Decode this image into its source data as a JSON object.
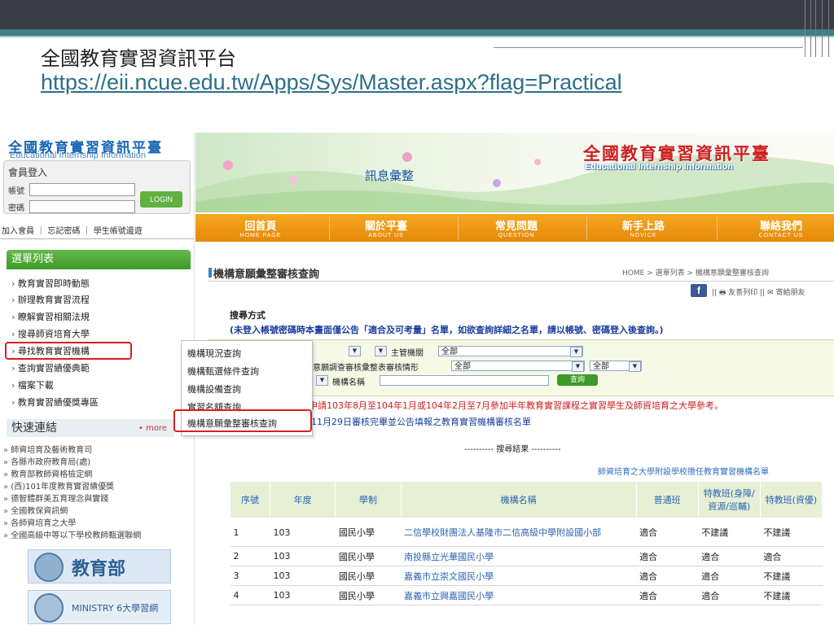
{
  "slide": {
    "title": "全國教育實習資訊平台",
    "url": "https://eii.ncue.edu.tw/Apps/Sys/Master.aspx?flag=Practical"
  },
  "site": {
    "logo_cn": "全國教育實習資訊平臺",
    "logo_en": "Educational Internship Information",
    "banner_center": "訊息彙整",
    "banner_cn": "全國教育實習資訊平臺",
    "banner_en": "Educational Internship Information"
  },
  "login": {
    "title": "會員登入",
    "account_label": "帳號",
    "password_label": "密碼",
    "button": "LOGIN",
    "links": "加入會員 ｜ 忘記密碼 ｜ 學生帳號邊遊"
  },
  "nav": [
    {
      "cn": "回首頁",
      "en": "HOME PAGE"
    },
    {
      "cn": "關於平臺",
      "en": "ABOUT US"
    },
    {
      "cn": "常見問題",
      "en": "QUESTION"
    },
    {
      "cn": "新手上路",
      "en": "NOVICE"
    },
    {
      "cn": "聯絡我們",
      "en": "CONTACT US"
    }
  ],
  "menu": {
    "header": "選單列表",
    "items": [
      "教育實習即時動態",
      "辦理教育實習流程",
      "瞭解實習相關法規",
      "搜尋師資培育大學",
      "尋找教育實習機構",
      "查詢實習績優典範",
      "檔案下載",
      "教育實習績優獎專區"
    ]
  },
  "flyout": [
    "機構現況查詢",
    "機構甄選條件查詢",
    "機構設備查詢",
    "實習名額查詢",
    "機構意願彙整審核查詢"
  ],
  "quick": {
    "header": "快速連結",
    "more": "• more",
    "items": [
      "師資培育及藝術教育司",
      "各縣市政府教育局(處)",
      "教育部教師資格檢定網",
      "(西)101年度教育實習績優獎",
      "德智體群美五育理念與實踐",
      "全國教保資訊網",
      "各師資培育之大學",
      "全國高級中等以下學校教師甄選聯網"
    ],
    "moe_text": "教育部",
    "moe2_text": "MINISTRY 6大學習網"
  },
  "page": {
    "heading": "機構意願彙整審核查詢",
    "breadcrumb": "HOME > 選單列表 > 機構意願彙整審核查詢",
    "fb": "f",
    "share": "|| 🖶 友善列印 || ✉ 寄給朋友",
    "search_title": "搜尋方式",
    "search_note": "(未登入帳號密碼時本畫面僅公告「適合及可考量」名單，如欲查詢詳細之名單，請以帳號、密碼登入後查詢。)",
    "filter_main_label": "主管機關",
    "filter_main_value": "全部",
    "filter_status_label": "意願調查審核彙整表審核情形",
    "filter_status_value": "全部",
    "filter_extra_value": "全部",
    "filter_name_label": "機構名稱",
    "query_button": "查詢",
    "red_note": "供申請103年8月至104年1月或104年2月至7月參加半年教育實習課程之實習學生及師資培育之大學參考。",
    "blue_note": "11月29日審核完畢並公告填報之教育實習機構審核名單",
    "result_label": "---------- 搜尋結果 ----------",
    "list_title": "師資培育之大學附設學校擔任教育實習機構名單"
  },
  "table": {
    "headers": [
      "序號",
      "年度",
      "學制",
      "機構名稱",
      "普通班",
      "特教班(身障/資源/巡輔)",
      "特教班(資優)"
    ],
    "rows": [
      [
        "1",
        "103",
        "國民小學",
        "二信學校財團法人基隆市二信高級中學附設國小部",
        "適合",
        "不建議",
        "不建議"
      ],
      [
        "2",
        "103",
        "國民小學",
        "南投縣立光華國民小學",
        "適合",
        "適合",
        "適合"
      ],
      [
        "3",
        "103",
        "國民小學",
        "嘉義市立崇文國民小學",
        "適合",
        "適合",
        "不建議"
      ],
      [
        "4",
        "103",
        "國民小學",
        "嘉義市立興嘉國民小學",
        "適合",
        "適合",
        "不建議"
      ]
    ]
  },
  "colors": {
    "slide_bar": "#3a3d47",
    "slide_teal": "#3e7e86",
    "menu_green": "#4fa836",
    "nav_orange": "#ef9a14",
    "highlight_red": "#d62020",
    "link_blue": "#2b64b1"
  }
}
